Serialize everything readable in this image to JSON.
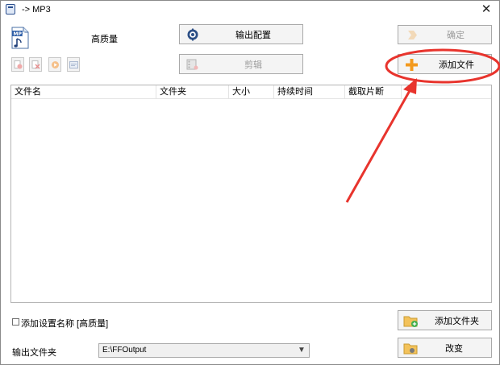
{
  "window": {
    "title": "-> MP3",
    "close_glyph": "✕"
  },
  "profile": {
    "icon": "mp3-file-icon",
    "label": "高质量"
  },
  "toolbar": {
    "output_config_label": "输出配置",
    "confirm_label": "确定",
    "edit_label": "剪辑",
    "add_file_label": "添加文件",
    "add_folder_label": "添加文件夹",
    "change_label": "改变",
    "small_buttons": [
      "remove-file-icon",
      "clear-list-icon",
      "play-icon",
      "media-info-icon"
    ]
  },
  "file_list": {
    "columns": [
      "文件名",
      "文件夹",
      "大小",
      "持续时间",
      "截取片断"
    ],
    "rows": []
  },
  "options": {
    "add_profile_name_label": "添加设置名称 [高质量]",
    "add_profile_name_checked": false
  },
  "output": {
    "label": "输出文件夹",
    "folder_value": "E:\\FFOutput"
  },
  "colors": {
    "annotation_red": "#e8342d",
    "accent_orange": "#f39a1e"
  }
}
